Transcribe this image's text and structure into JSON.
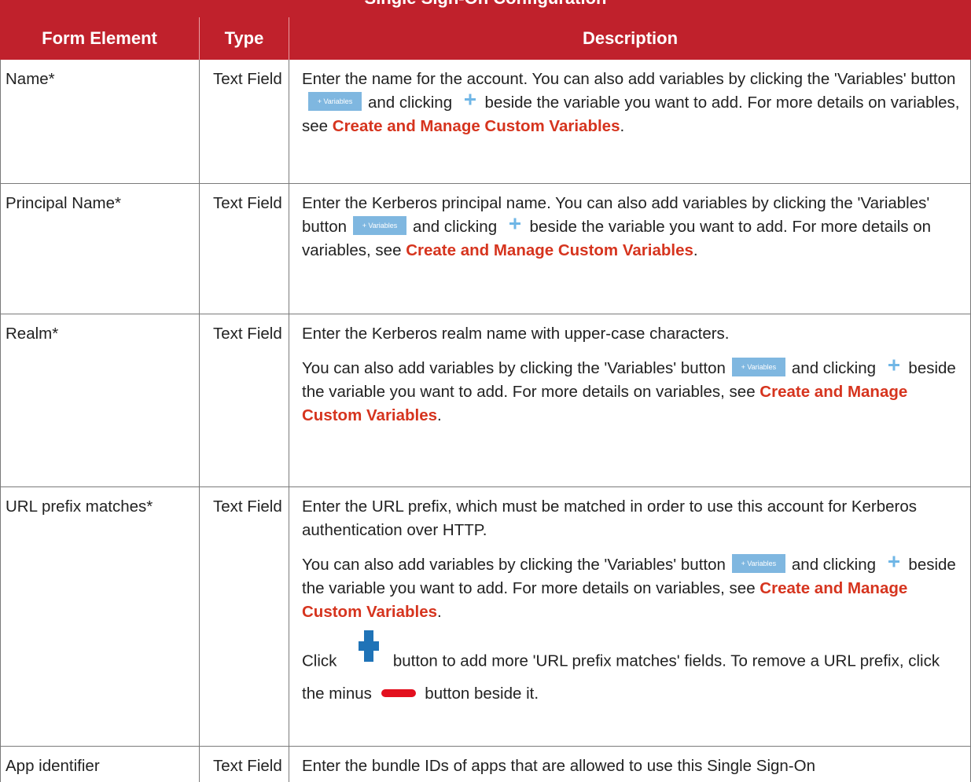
{
  "caption": "Single Sign-On Configuration",
  "columns": {
    "form_element": "Form Element",
    "type": "Type",
    "description": "Description"
  },
  "common": {
    "variables_button": "+ Variables",
    "link_text": "Create and Manage Custom Variables"
  },
  "rows": [
    {
      "element": "Name*",
      "type": "Text Field",
      "d_intro": "Enter the name for the account. You can also add variables by clicking the 'Variables' button",
      "d_mid": "and clicking",
      "d_after": "beside the variable you want to add. For more details on variables, see",
      "d_end": "."
    },
    {
      "element": "Principal Name*",
      "type": "Text Field",
      "d_intro": "Enter the Kerberos principal name. You can also add variables by clicking the 'Variables' button",
      "d_mid": "and clicking",
      "d_after": "beside the variable you want to add. For more details on variables, see",
      "d_end": "."
    },
    {
      "element": "Realm*",
      "type": "Text Field",
      "d_p1": "Enter the Kerberos realm name with upper-case characters.",
      "d_intro": "You can also add variables by clicking the 'Variables' button",
      "d_mid": "and clicking",
      "d_after": "beside the variable you want to add. For more details on variables, see",
      "d_end": "."
    },
    {
      "element": "URL prefix matches*",
      "type": "Text Field",
      "d_p1": "Enter the URL prefix, which must be matched in order to use this account for Kerberos authentication over HTTP.",
      "d_intro": "You can also add variables by clicking the 'Variables' button",
      "d_mid": "and clicking",
      "d_after": "beside the variable you want to add. For more details on variables, see",
      "d_end": ".",
      "d_click": "Click",
      "d_add": "button to add more 'URL prefix matches' fields. To remove a URL prefix, click the minus",
      "d_remove": "button beside it."
    },
    {
      "element": "App identifier",
      "type": "Text Field",
      "d_p1": "Enter the bundle IDs of apps that are allowed to use this Single Sign-On"
    }
  ],
  "colors": {
    "header_bg": "#c0212c",
    "link": "#d6341e",
    "variables_btn": "#7fb7e0",
    "plus_small": "#6fb6e6",
    "plus_big": "#1f73b7",
    "minus": "#e3101e"
  }
}
